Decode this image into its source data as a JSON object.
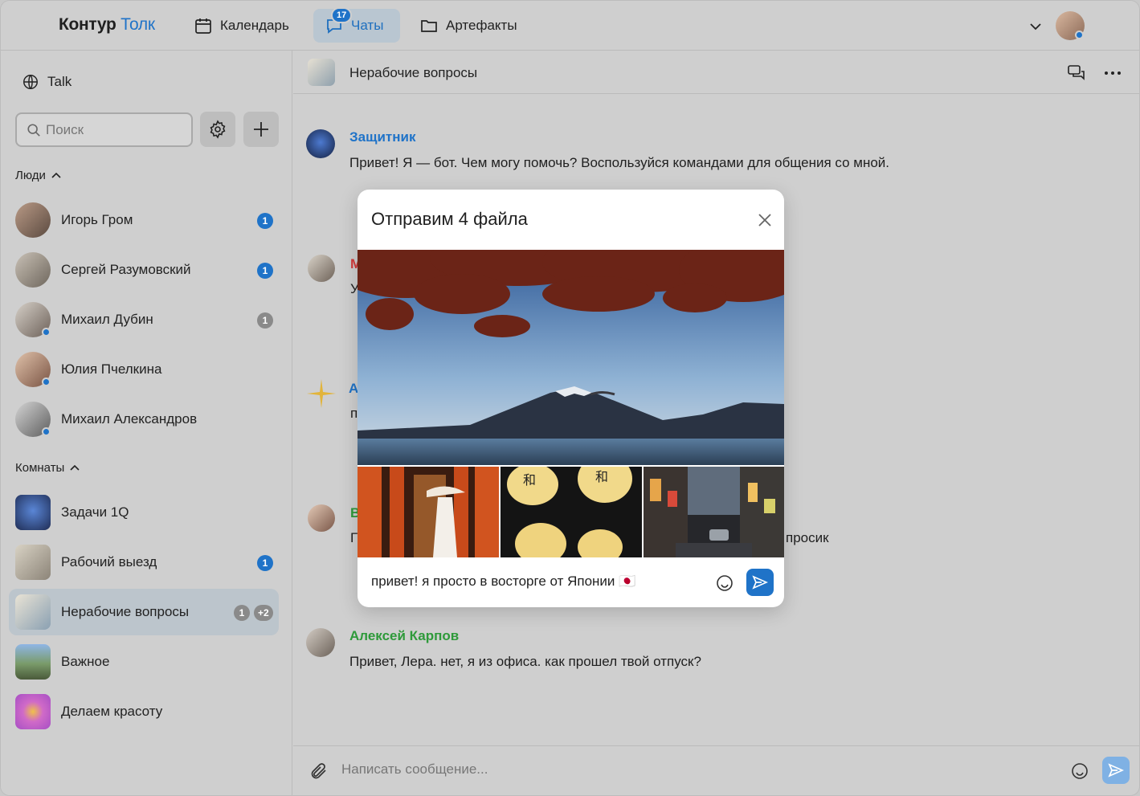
{
  "topbar": {
    "logo_main": "Контур",
    "logo_accent": "Толк",
    "nav": [
      {
        "label": "Календарь",
        "icon": "calendar-icon"
      },
      {
        "label": "Чаты",
        "icon": "chat-icon",
        "badge": "17",
        "active": true
      },
      {
        "label": "Артефакты",
        "icon": "folder-icon"
      }
    ]
  },
  "sidebar": {
    "workspace": "Talk",
    "search_placeholder": "Поиск",
    "people_title": "Люди",
    "people": [
      {
        "name": "Игорь Гром",
        "count": "1",
        "count_style": "blue",
        "online": false
      },
      {
        "name": "Сергей Разумовский",
        "count": "1",
        "count_style": "blue",
        "online": false
      },
      {
        "name": "Михаил Дубин",
        "count": "1",
        "count_style": "gray",
        "online": true
      },
      {
        "name": "Юлия Пчелкина",
        "count": "",
        "online": true
      },
      {
        "name": "Михаил Александров",
        "count": "",
        "online": true
      }
    ],
    "rooms_title": "Комнаты",
    "rooms": [
      {
        "name": "Задачи 1Q",
        "count": ""
      },
      {
        "name": "Рабочий выезд",
        "count": "1"
      },
      {
        "name": "Нерабочие вопросы",
        "count": "1",
        "extra": "+2",
        "selected": true
      },
      {
        "name": "Важное",
        "count": ""
      },
      {
        "name": "Делаем красоту",
        "count": ""
      }
    ]
  },
  "chat": {
    "title": "Нерабочие вопросы",
    "messages": [
      {
        "author": "Защитник",
        "author_color": "#1f73c8",
        "text": "Привет! Я — бот. Чем могу помочь? Воспользуйся командами для общения со мной."
      },
      {
        "author": "Алексей Карпов",
        "author_color": "#2e9a3a",
        "text": "Привет, Лера. нет, я из офиса. как прошел твой отпуск?"
      }
    ],
    "partials": {
      "m_author": "М",
      "m_text": "У",
      "a_author": "А",
      "a_text": "п",
      "v_author": "В",
      "v_text_start": "Г",
      "v_text_end": "просик"
    },
    "composer_placeholder": "Написать сообщение..."
  },
  "modal": {
    "title": "Отправим 4 файла",
    "caption": "привет! я просто в восторге от Японии 🇯🇵"
  },
  "colors": {
    "accent": "#1f73c8",
    "green": "#2e9a3a",
    "red": "#d23a3a"
  }
}
